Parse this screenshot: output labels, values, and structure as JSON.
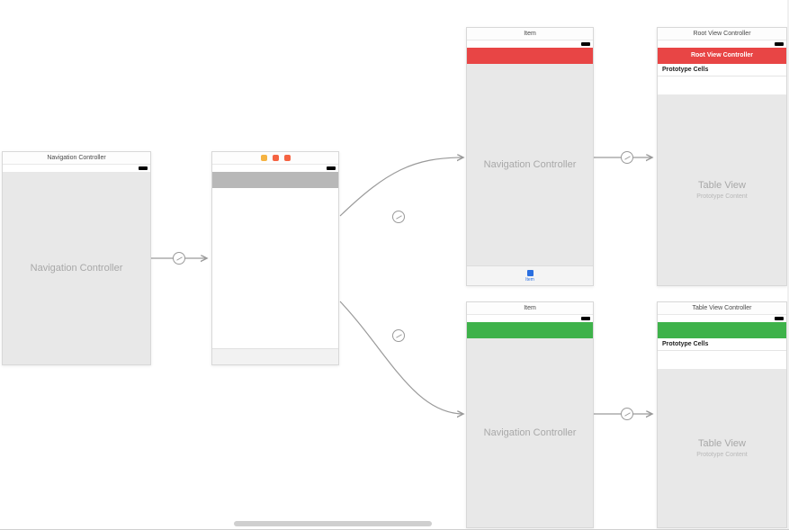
{
  "scenes": {
    "nav1": {
      "title": "Navigation Controller",
      "placeholder": "Navigation Controller"
    },
    "tab_vc": {
      "tab_label": "Item"
    },
    "nav_red": {
      "title": "Item",
      "placeholder": "Navigation Controller"
    },
    "nav_green": {
      "title": "Item",
      "placeholder": "Navigation Controller"
    },
    "root_red": {
      "title": "Root View Controller",
      "navbar_label": "Root View Controller",
      "proto_label": "Prototype Cells",
      "placeholder": "Table View",
      "placeholder_sub": "Prototype Content"
    },
    "root_green": {
      "title": "Table View Controller",
      "proto_label": "Prototype Cells",
      "placeholder": "Table View",
      "placeholder_sub": "Prototype Content"
    }
  }
}
